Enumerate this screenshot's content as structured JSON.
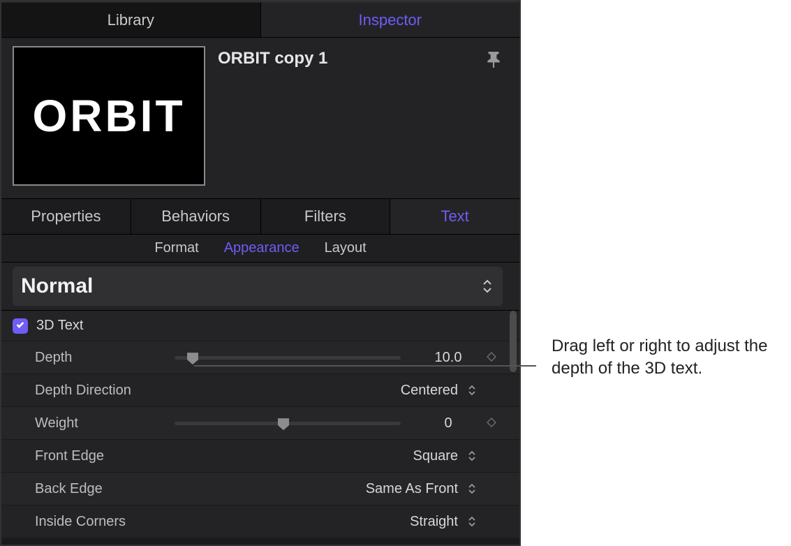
{
  "topTabs": {
    "library": "Library",
    "inspector": "Inspector"
  },
  "layer": {
    "title": "ORBIT copy 1",
    "previewText": "ORBIT"
  },
  "subTabs": {
    "properties": "Properties",
    "behaviors": "Behaviors",
    "filters": "Filters",
    "text": "Text"
  },
  "miniTabs": {
    "format": "Format",
    "appearance": "Appearance",
    "layout": "Layout"
  },
  "styleDropdown": {
    "value": "Normal"
  },
  "section3D": {
    "label": "3D Text",
    "enabled": true
  },
  "params": {
    "depth": {
      "label": "Depth",
      "value": "10.0",
      "sliderPercent": 8
    },
    "depthDirection": {
      "label": "Depth Direction",
      "value": "Centered"
    },
    "weight": {
      "label": "Weight",
      "value": "0",
      "sliderPercent": 48
    },
    "frontEdge": {
      "label": "Front Edge",
      "value": "Square"
    },
    "backEdge": {
      "label": "Back Edge",
      "value": "Same As Front"
    },
    "insideCorners": {
      "label": "Inside Corners",
      "value": "Straight"
    }
  },
  "callout": "Drag left or right to adjust the depth of the 3D text."
}
